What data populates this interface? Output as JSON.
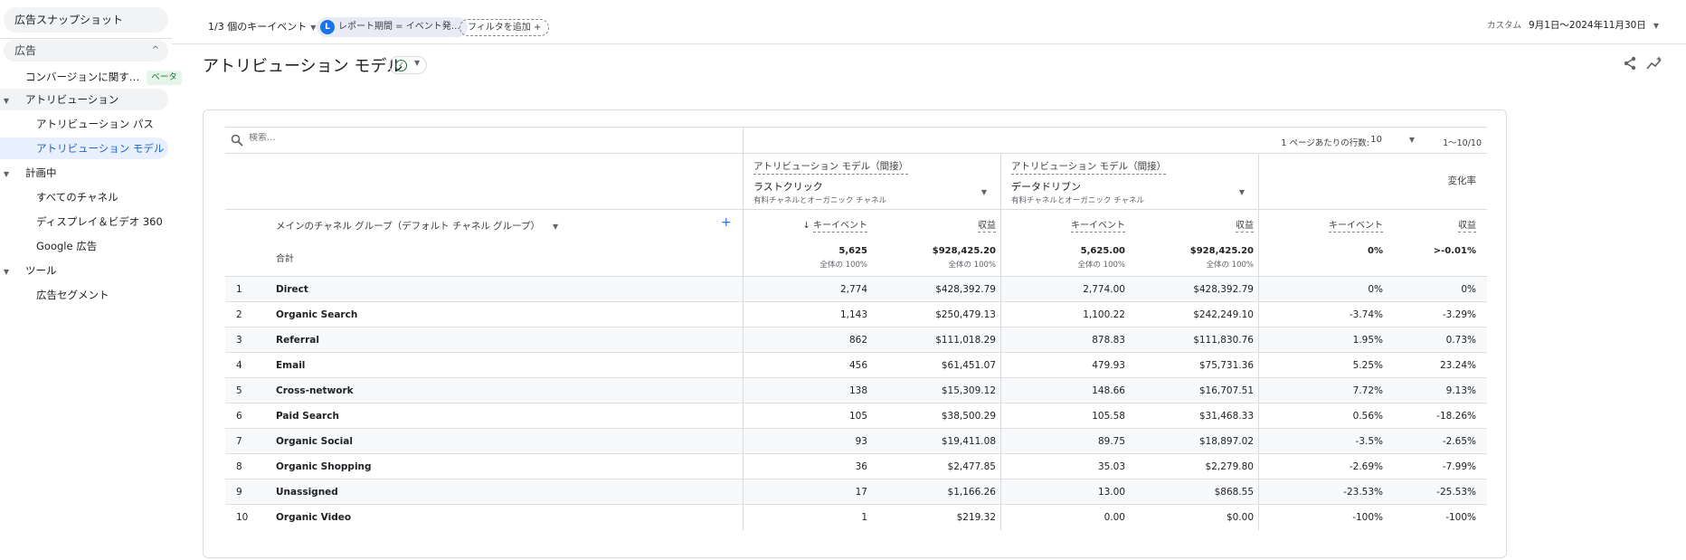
{
  "sidebar": {
    "top_item": "広告スナップショット",
    "section": "広告",
    "items": [
      {
        "label": "コンバージョンに関す…",
        "badge": "ベータ"
      },
      {
        "label": "アトリビューション"
      },
      {
        "label": "アトリビューション パス"
      },
      {
        "label": "アトリビューション モデル"
      },
      {
        "label": "計画中"
      },
      {
        "label": "すべてのチャネル"
      },
      {
        "label": "ディスプレイ＆ビデオ 360"
      },
      {
        "label": "Google 広告"
      },
      {
        "label": "ツール"
      },
      {
        "label": "広告セグメント"
      }
    ]
  },
  "topbar": {
    "key_events": "1/3 個のキーイベント",
    "period_chip_letter": "L",
    "period_chip": "レポート期間 = イベント発…",
    "add_filter": "フィルタを追加",
    "date_prefix": "カスタム",
    "date_range": "9月1日～2024年11月30日"
  },
  "page": {
    "title": "アトリビューション モデル"
  },
  "table": {
    "search_placeholder": "検索...",
    "rows_per_page_label": "1 ページあたりの行数:",
    "rows_per_page": "10",
    "range": "1～10/10",
    "model_left": {
      "title": "アトリビューション モデル（間接）",
      "name": "ラストクリック",
      "sub": "有料チャネルとオーガニック チャネル"
    },
    "model_right": {
      "title": "アトリビューション モデル（間接）",
      "name": "データドリブン",
      "sub": "有料チャネルとオーガニック チャネル"
    },
    "change_header": "変化率",
    "dimension_header": "メインのチャネル グループ（デフォルト チャネル グループ）",
    "metric_headers": {
      "key_events_sorted": "キーイベント",
      "revenue": "収益",
      "key_events": "キーイベント"
    },
    "totals": {
      "label": "合計",
      "sub": "全体の 100%",
      "values": [
        "5,625",
        "$928,425.20",
        "5,625.00",
        "$928,425.20",
        "0%",
        ">-0.01%"
      ]
    },
    "rows": [
      {
        "idx": "1",
        "channel": "Direct",
        "v": [
          "2,774",
          "$428,392.79",
          "2,774.00",
          "$428,392.79",
          "0%",
          "0%"
        ]
      },
      {
        "idx": "2",
        "channel": "Organic Search",
        "v": [
          "1,143",
          "$250,479.13",
          "1,100.22",
          "$242,249.10",
          "-3.74%",
          "-3.29%"
        ]
      },
      {
        "idx": "3",
        "channel": "Referral",
        "v": [
          "862",
          "$111,018.29",
          "878.83",
          "$111,830.76",
          "1.95%",
          "0.73%"
        ]
      },
      {
        "idx": "4",
        "channel": "Email",
        "v": [
          "456",
          "$61,451.07",
          "479.93",
          "$75,731.36",
          "5.25%",
          "23.24%"
        ]
      },
      {
        "idx": "5",
        "channel": "Cross-network",
        "v": [
          "138",
          "$15,309.12",
          "148.66",
          "$16,707.51",
          "7.72%",
          "9.13%"
        ]
      },
      {
        "idx": "6",
        "channel": "Paid Search",
        "v": [
          "105",
          "$38,500.29",
          "105.58",
          "$31,468.33",
          "0.56%",
          "-18.26%"
        ]
      },
      {
        "idx": "7",
        "channel": "Organic Social",
        "v": [
          "93",
          "$19,411.08",
          "89.75",
          "$18,897.02",
          "-3.5%",
          "-2.65%"
        ]
      },
      {
        "idx": "8",
        "channel": "Organic Shopping",
        "v": [
          "36",
          "$2,477.85",
          "35.03",
          "$2,279.80",
          "-2.69%",
          "-7.99%"
        ]
      },
      {
        "idx": "9",
        "channel": "Unassigned",
        "v": [
          "17",
          "$1,166.26",
          "13.00",
          "$868.55",
          "-23.53%",
          "-25.53%"
        ]
      },
      {
        "idx": "10",
        "channel": "Organic Video",
        "v": [
          "1",
          "$219.32",
          "0.00",
          "$0.00",
          "-100%",
          "-100%"
        ]
      }
    ]
  }
}
